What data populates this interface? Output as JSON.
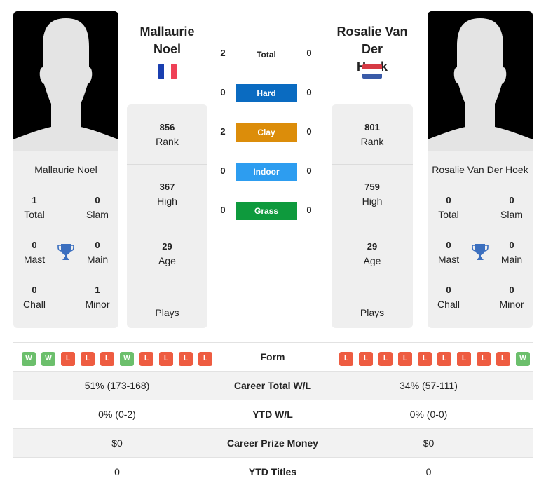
{
  "player1": {
    "name": "Mallaurie Noel",
    "header_name_line1": "Mallaurie",
    "header_name_line2": "Noel",
    "flag": "France",
    "flag_colors": [
      "#0033a0",
      "#ffffff",
      "#ef4056"
    ],
    "titles": {
      "total": {
        "value": "1",
        "label": "Total"
      },
      "slam": {
        "value": "0",
        "label": "Slam"
      },
      "mast": {
        "value": "0",
        "label": "Mast"
      },
      "main": {
        "value": "0",
        "label": "Main"
      },
      "chall": {
        "value": "0",
        "label": "Chall"
      },
      "minor": {
        "value": "1",
        "label": "Minor"
      }
    },
    "stats": {
      "rank": {
        "value": "856",
        "label": "Rank"
      },
      "high": {
        "value": "367",
        "label": "High"
      },
      "age": {
        "value": "29",
        "label": "Age"
      },
      "plays": {
        "value": "",
        "label": "Plays"
      }
    },
    "form": [
      "W",
      "W",
      "L",
      "L",
      "L",
      "W",
      "L",
      "L",
      "L",
      "L"
    ]
  },
  "player2": {
    "name": "Rosalie Van Der Hoek",
    "header_name_line1": "Rosalie Van Der",
    "header_name_line2": "Hoek",
    "flag": "Netherlands",
    "flag_colors": [
      "#d63a44",
      "#ffffff",
      "#3a5ba8"
    ],
    "titles": {
      "total": {
        "value": "0",
        "label": "Total"
      },
      "slam": {
        "value": "0",
        "label": "Slam"
      },
      "mast": {
        "value": "0",
        "label": "Mast"
      },
      "main": {
        "value": "0",
        "label": "Main"
      },
      "chall": {
        "value": "0",
        "label": "Chall"
      },
      "minor": {
        "value": "0",
        "label": "Minor"
      }
    },
    "stats": {
      "rank": {
        "value": "801",
        "label": "Rank"
      },
      "high": {
        "value": "759",
        "label": "High"
      },
      "age": {
        "value": "29",
        "label": "Age"
      },
      "plays": {
        "value": "",
        "label": "Plays"
      }
    },
    "form": [
      "L",
      "L",
      "L",
      "L",
      "L",
      "L",
      "L",
      "L",
      "L",
      "W"
    ]
  },
  "h2h": [
    {
      "label": "Total",
      "p1": "2",
      "p2": "0",
      "color": ""
    },
    {
      "label": "Hard",
      "p1": "0",
      "p2": "0",
      "color": "#0a6bc1"
    },
    {
      "label": "Clay",
      "p1": "2",
      "p2": "0",
      "color": "#dc8d0a"
    },
    {
      "label": "Indoor",
      "p1": "0",
      "p2": "0",
      "color": "#2d9df0"
    },
    {
      "label": "Grass",
      "p1": "0",
      "p2": "0",
      "color": "#0e9a3d"
    }
  ],
  "comparison": {
    "form_label": "Form",
    "rows": [
      {
        "label": "Career Total W/L",
        "p1": "51% (173-168)",
        "p2": "34% (57-111)"
      },
      {
        "label": "YTD W/L",
        "p1": "0% (0-2)",
        "p2": "0% (0-0)"
      },
      {
        "label": "Career Prize Money",
        "p1": "$0",
        "p2": "$0"
      },
      {
        "label": "YTD Titles",
        "p1": "0",
        "p2": "0"
      }
    ]
  },
  "icons": {
    "trophy": "trophy-icon",
    "silhouette": "player-silhouette"
  },
  "colors": {
    "trophy": "#3b6fbf",
    "win": "#6cbf6c",
    "loss": "#ee5c41",
    "card_bg": "#efefef"
  }
}
